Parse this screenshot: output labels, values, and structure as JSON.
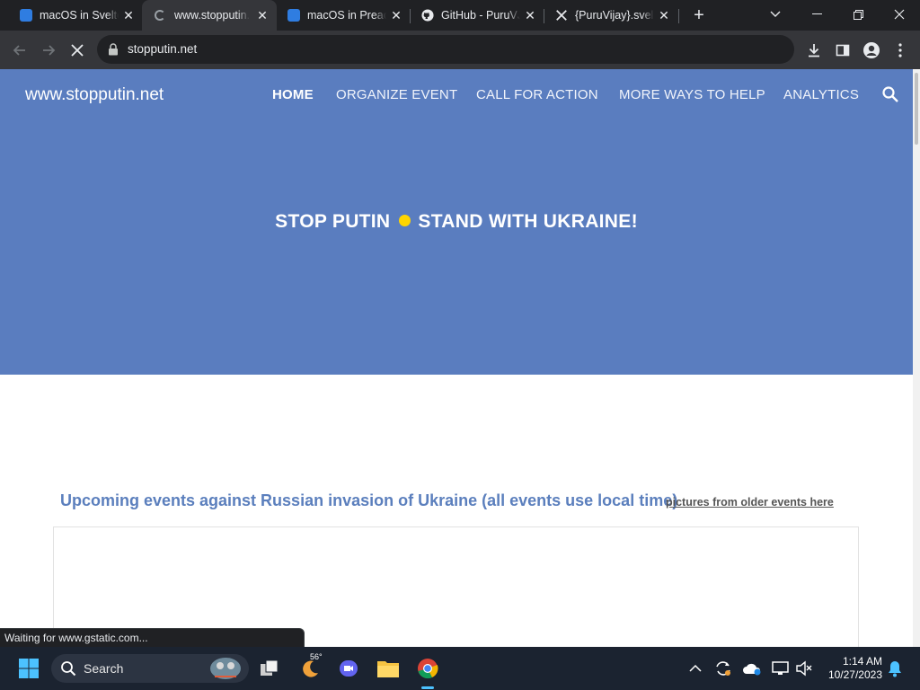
{
  "browser": {
    "tabs": [
      {
        "title": "macOS in Svelte",
        "favicon": "macos-finder-icon",
        "active": false
      },
      {
        "title": "www.stopputin.net",
        "favicon": "globe-loading-icon",
        "active": true
      },
      {
        "title": "macOS in Preact",
        "favicon": "macos-finder-icon",
        "active": false
      },
      {
        "title": "GitHub - PuruVJ/macos-web",
        "favicon": "github-icon",
        "active": false
      },
      {
        "title": "{PuruVijay}.svelte",
        "favicon": "x-icon",
        "active": false
      }
    ],
    "close_glyph": "✕",
    "new_tab_glyph": "+",
    "url": "stopputin.net",
    "status_text": "Waiting for www.gstatic.com..."
  },
  "site": {
    "name": "www.stopputin.net",
    "nav": [
      {
        "label": "HOME",
        "active": true
      },
      {
        "label": "ORGANIZE EVENT",
        "active": false
      },
      {
        "label": "CALL FOR ACTION",
        "active": false
      },
      {
        "label": "MORE WAYS TO HELP",
        "active": false
      },
      {
        "label": "ANALYTICS",
        "active": false
      }
    ],
    "hero_left": "STOP PUTIN",
    "hero_right": "STAND WITH UKRAINE!",
    "events_heading": "Upcoming events against Russian invasion of Ukraine (all events use local time)",
    "events_link": "pictures from older events here",
    "colors": {
      "hero_bg": "#5a7dbf",
      "dot": "#ffd500",
      "heading": "#5b7fbd"
    }
  },
  "taskbar": {
    "search_label": "Search",
    "temperature": "56°",
    "time": "1:14 AM",
    "date": "10/27/2023"
  }
}
